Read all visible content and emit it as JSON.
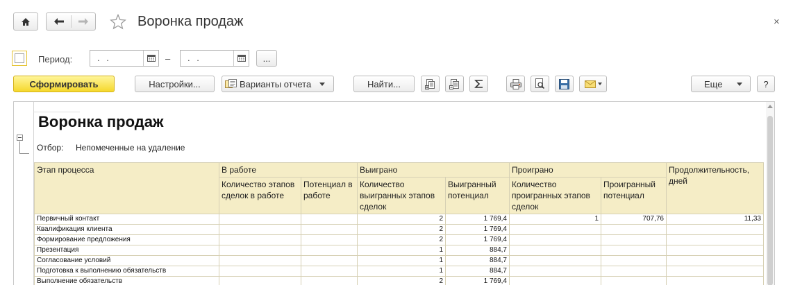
{
  "window": {
    "title": "Воронка продаж",
    "close_glyph": "×"
  },
  "icons": {
    "home": "home-icon",
    "back": "arrow-left-icon",
    "forward": "arrow-right-icon",
    "favorite": "star-icon",
    "close": "close-icon"
  },
  "period": {
    "label": "Период:",
    "from_value": ". .",
    "to_value": ". .",
    "dash": "–",
    "more": "..."
  },
  "toolbar": {
    "generate": "Сформировать",
    "settings": "Настройки...",
    "variants": "Варианты отчета",
    "find": "Найти...",
    "more": "Еще",
    "help": "?",
    "accent_color": "#f5d82c"
  },
  "report": {
    "title": "Воронка продаж",
    "filter_label": "Отбор:",
    "filter_value": "Непомеченные на удаление",
    "header": {
      "stage": "Этап процесса",
      "in_work": "В работе",
      "won": "Выиграно",
      "lost": "Проиграно",
      "duration": "Продолжительность, дней",
      "in_work_count": "Количество этапов сделок в работе",
      "in_work_potential": "Потенциал в работе",
      "won_count": "Количество выигранных этапов сделок",
      "won_potential": "Выигранный потенциал",
      "lost_count": "Количество проигранных этапов сделок",
      "lost_potential": "Проигранный потенциал"
    },
    "rows": [
      {
        "stage": "Первичный контакт",
        "in_work_count": "",
        "in_work_potential": "",
        "won_count": "2",
        "won_potential": "1 769,4",
        "lost_count": "1",
        "lost_potential": "707,76",
        "duration": "11,33"
      },
      {
        "stage": "Квалификация клиента",
        "in_work_count": "",
        "in_work_potential": "",
        "won_count": "2",
        "won_potential": "1 769,4",
        "lost_count": "",
        "lost_potential": "",
        "duration": ""
      },
      {
        "stage": "Формирование предложения",
        "in_work_count": "",
        "in_work_potential": "",
        "won_count": "2",
        "won_potential": "1 769,4",
        "lost_count": "",
        "lost_potential": "",
        "duration": ""
      },
      {
        "stage": "Презентация",
        "in_work_count": "",
        "in_work_potential": "",
        "won_count": "1",
        "won_potential": "884,7",
        "lost_count": "",
        "lost_potential": "",
        "duration": ""
      },
      {
        "stage": "Согласование условий",
        "in_work_count": "",
        "in_work_potential": "",
        "won_count": "1",
        "won_potential": "884,7",
        "lost_count": "",
        "lost_potential": "",
        "duration": ""
      },
      {
        "stage": "Подготовка к выполнению обязательств",
        "in_work_count": "",
        "in_work_potential": "",
        "won_count": "1",
        "won_potential": "884,7",
        "lost_count": "",
        "lost_potential": "",
        "duration": ""
      },
      {
        "stage": "Выполнение обязательств",
        "in_work_count": "",
        "in_work_potential": "",
        "won_count": "2",
        "won_potential": "1 769,4",
        "lost_count": "",
        "lost_potential": "",
        "duration": ""
      }
    ]
  }
}
